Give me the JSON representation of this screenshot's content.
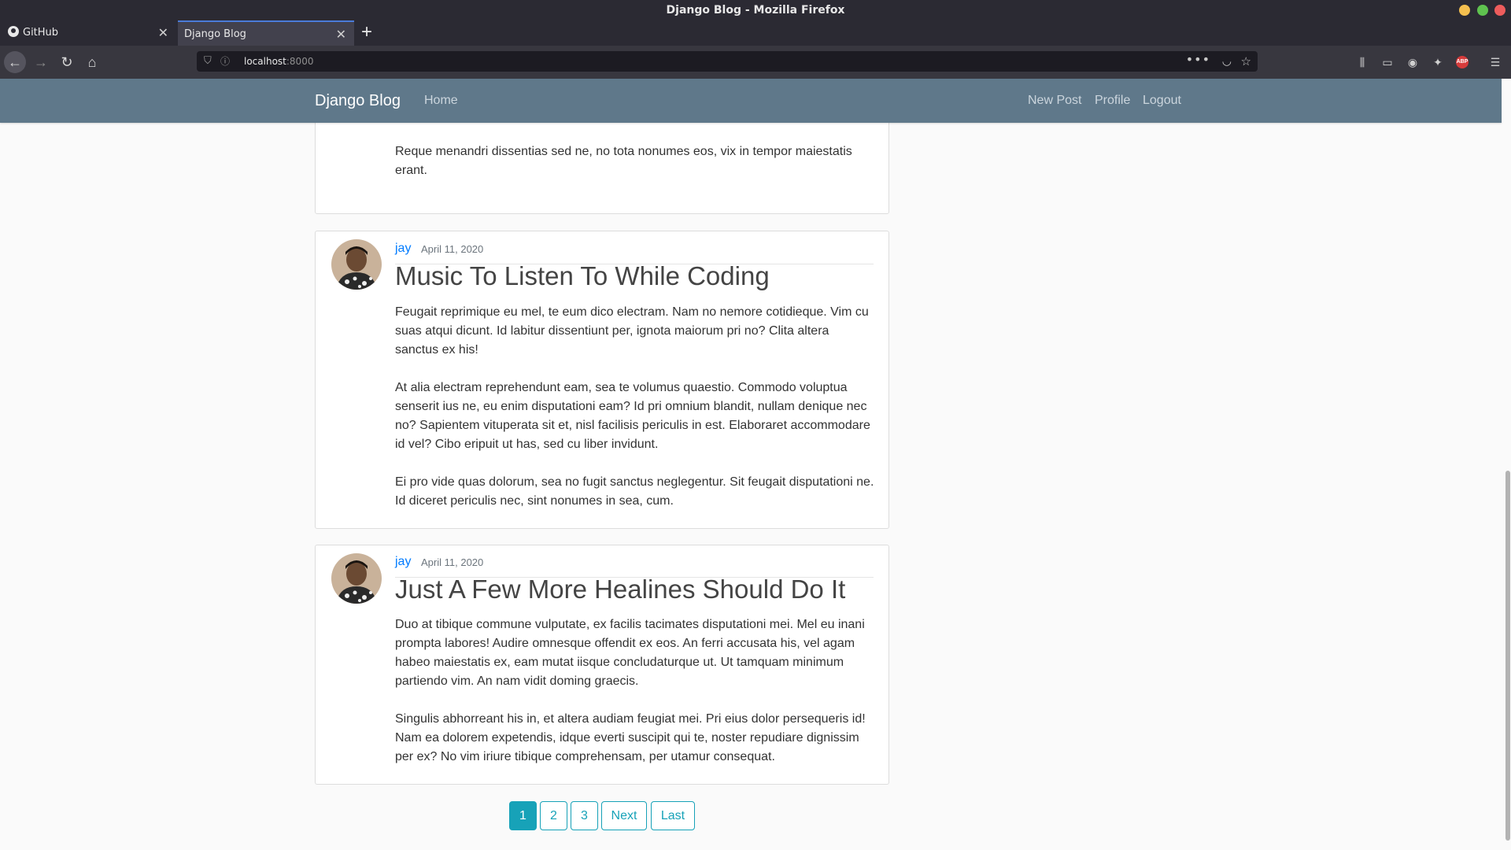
{
  "window": {
    "title": "Django Blog - Mozilla Firefox"
  },
  "tabs": [
    {
      "label": "GitHub"
    },
    {
      "label": "Django Blog"
    }
  ],
  "url": {
    "host": "localhost",
    "port": ":8000"
  },
  "site": {
    "brand": "Django Blog",
    "nav_left": [
      "Home"
    ],
    "nav_right": [
      "New Post",
      "Profile",
      "Logout"
    ]
  },
  "partial_post": {
    "body": "imperdiet? Natum quaeque intellegebat per ex. Cu viris clita sit?\n\nReque menandri dissentias sed ne, no tota nonumes eos, vix in tempor maiestatis erant."
  },
  "posts": [
    {
      "author": "jay",
      "date": "April 11, 2020",
      "title": "Music To Listen To While Coding",
      "body": "Feugait reprimique eu mel, te eum dico electram. Nam no nemore cotidieque. Vim cu suas atqui dicunt. Id labitur dissentiunt per, ignota maiorum pri no? Clita altera sanctus ex his!\n\nAt alia electram reprehendunt eam, sea te volumus quaestio. Commodo voluptua senserit ius ne, eu enim disputationi eam? Id pri omnium blandit, nullam denique nec no? Sapientem vituperata sit et, nisl facilisis periculis in est. Elaboraret accommodare id vel? Cibo eripuit ut has, sed cu liber invidunt.\n\nEi pro vide quas dolorum, sea no fugit sanctus neglegentur. Sit feugait disputationi ne. Id diceret periculis nec, sint nonumes in sea, cum."
    },
    {
      "author": "jay",
      "date": "April 11, 2020",
      "title": "Just A Few More Healines Should Do It",
      "body": "Duo at tibique commune vulputate, ex facilis tacimates disputationi mei. Mel eu inani prompta labores! Audire omnesque offendit ex eos. An ferri accusata his, vel agam habeo maiestatis ex, eam mutat iisque concludaturque ut. Ut tamquam minimum partiendo vim. An nam vidit doming graecis.\n\nSingulis abhorreant his in, et altera audiam feugiat mei. Pri eius dolor persequeris id! Nam ea dolorem expetendis, idque everti suscipit qui te, noster repudiare dignissim per ex? No vim iriure tibique comprehensam, per utamur consequat."
    }
  ],
  "pagination": [
    "1",
    "2",
    "3",
    "Next",
    "Last"
  ],
  "colors": {
    "header": "#5f788a",
    "accent": "#17a2b8",
    "link": "#007bff"
  }
}
